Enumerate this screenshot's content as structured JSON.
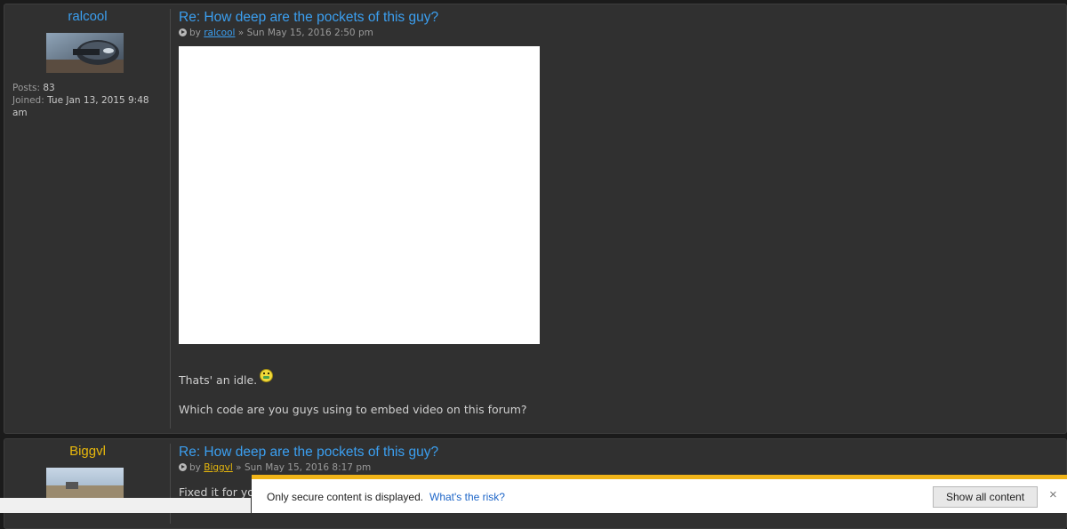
{
  "posts": [
    {
      "username": "ralcool",
      "username_color": "#3b9ff0",
      "stats": {
        "posts_label": "Posts:",
        "posts_value": "83",
        "joined_label": "Joined:",
        "joined_value": "Tue Jan 13, 2015 9:48 am"
      },
      "title": "Re: How deep are the pockets of this guy?",
      "meta_by": "by",
      "author": "ralcool",
      "date_sep": "»",
      "date": "Sun May 15, 2016 2:50 pm",
      "lines": [
        "Thats' an idle.",
        "Which code are you guys using to embed video on this forum?"
      ],
      "emoji": "sick-smiley-icon"
    },
    {
      "username": "Biggvl",
      "username_color": "#e8b80c",
      "title": "Re: How deep are the pockets of this guy?",
      "meta_by": "by",
      "author": "Biggvl",
      "date_sep": "»",
      "date": "Sun May 15, 2016 8:17 pm",
      "lines": [
        "Fixed it for yo"
      ]
    }
  ],
  "infobar": {
    "message": "Only secure content is displayed.",
    "risk_link": "What's the risk?",
    "button": "Show all content",
    "close": "×",
    "accent": "#f0b418"
  }
}
